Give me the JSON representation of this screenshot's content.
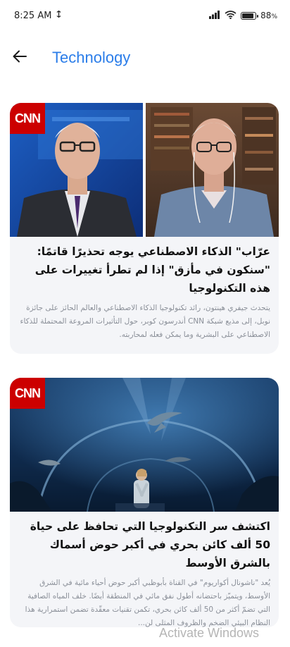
{
  "status_bar": {
    "time": "8:25 AM",
    "battery": "88",
    "battery_unit": "%",
    "battery_level": 0.88
  },
  "app_bar": {
    "title": "Technology",
    "back_icon": "arrow-left-icon"
  },
  "articles": [
    {
      "source": "CNN",
      "headline": "عرّاب\" الذكاء الاصطناعي يوجه تحذيرًا قاتمًا: \"سنكون في مأزق\" إذا لم تطرأ تغييرات على هذه التكنولوجيا",
      "summary": "يتحدث جيفري هينتون، رائد تكنولوجيا الذكاء الاصطناعي والعالم الحائز على جائزة نوبل، إلى مذيع شبكة CNN أندرسون كوبر، حول التأثيرات المروعة المحتملة للذكاء الاصطناعي على البشرية وما يمكن فعله لمحاربته."
    },
    {
      "source": "CNN",
      "headline": "اكتشف سر التكنولوجيا التي تحافظ على حياة 50 ألف كائن بحري في أكبر حوض أسماك بالشرق الأوسط",
      "summary": "يُعد \"ناشونال أكواريوم\" في القناة بأبوظبي أكبر حوض أحياء مائية في الشرق الأوسط، ويتميّز باحتضانه أطول نفق مائي في المنطقة أيضًا. خلف المياه الصافية التي تضمّ أكثر من 50 ألف كائن بحري، تكمن تقنيات معقّدة تضمن استمرارية هذا النظام البيئي الضخم والظروف المثلى لن..."
    }
  ],
  "watermark": "Activate Windows",
  "colors": {
    "accent": "#2b7de9",
    "cnn_red": "#cc0000",
    "card_bg": "#f4f5f8"
  }
}
